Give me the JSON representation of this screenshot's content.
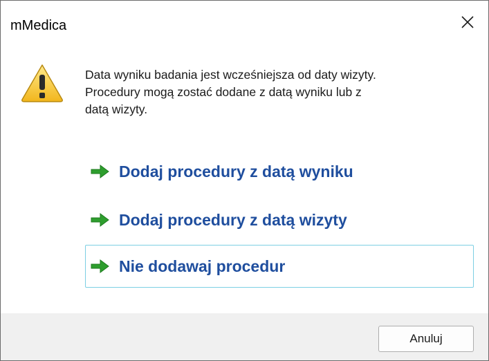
{
  "window": {
    "title": "mMedica",
    "close_icon": "close-icon"
  },
  "message": {
    "icon": "warning-icon",
    "lines": [
      "Data wyniku badania jest wcześniejsza od daty wizyty.",
      "Procedury mogą zostać dodane z datą wyniku lub z",
      "datą wizyty."
    ]
  },
  "commands": [
    {
      "label": "Dodaj procedury z datą wyniku",
      "icon": "green-arrow-icon"
    },
    {
      "label": "Dodaj procedury z datą wizyty",
      "icon": "green-arrow-icon"
    },
    {
      "label": "Nie dodawaj procedur",
      "icon": "green-arrow-icon",
      "focused": true
    }
  ],
  "footer": {
    "cancel_label": "Anuluj"
  },
  "colors": {
    "command_text": "#1f4e9e",
    "arrow_green": "#2e9e2e",
    "focus_border": "#7ccfe3",
    "footer_bg": "#f0f0f0",
    "warning_yellow": "#f4c430"
  }
}
